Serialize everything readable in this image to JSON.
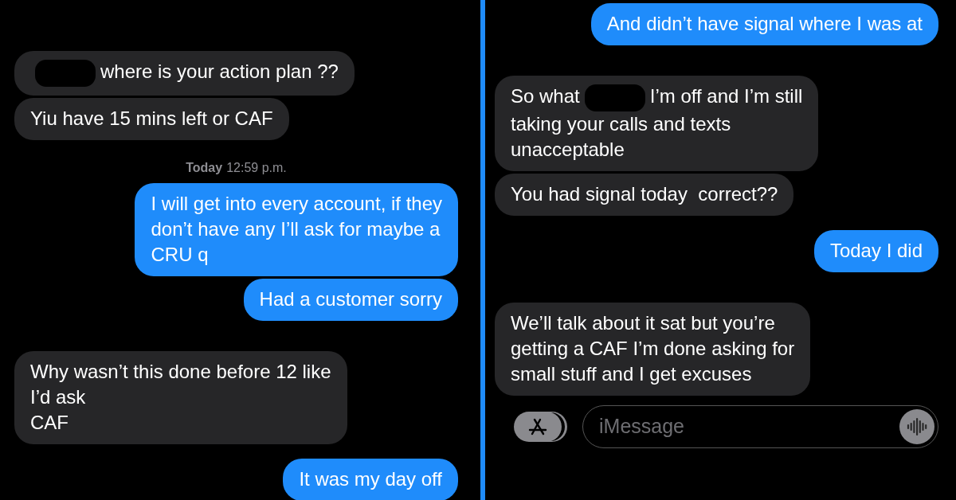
{
  "panels": [
    {
      "messages": [
        {
          "kind": "received",
          "segments": [
            {
              "kind": "redacted"
            },
            {
              "kind": "text",
              "text": "where is your action plan ??"
            }
          ]
        },
        {
          "kind": "received",
          "segments": [
            {
              "kind": "text",
              "text": "Yiu have 15 mins left or CAF"
            }
          ]
        },
        {
          "kind": "timestamp",
          "day": "Today",
          "time": "12:59 p.m."
        },
        {
          "kind": "sent",
          "segments": [
            {
              "kind": "text",
              "text": "I will get into every account, if they\ndon’t have any I’ll ask for maybe a\nCRU q"
            }
          ]
        },
        {
          "kind": "sent",
          "segments": [
            {
              "kind": "text",
              "text": "Had a customer sorry"
            }
          ]
        },
        {
          "kind": "received",
          "segments": [
            {
              "kind": "text",
              "text": "Why wasn’t this done before 12 like\nI’d ask\nCAF"
            }
          ]
        },
        {
          "kind": "sent",
          "segments": [
            {
              "kind": "text",
              "text": "It was my day off"
            }
          ]
        }
      ]
    },
    {
      "messages": [
        {
          "kind": "sent",
          "segments": [
            {
              "kind": "text",
              "text": "And didn’t have signal where I was at"
            }
          ]
        },
        {
          "kind": "received",
          "segments": [
            {
              "kind": "text",
              "text": "So what"
            },
            {
              "kind": "redacted"
            },
            {
              "kind": "text",
              "text": "I’m off and I’m still\ntaking your calls and texts\nunacceptable"
            }
          ]
        },
        {
          "kind": "received",
          "segments": [
            {
              "kind": "text",
              "text": "You had signal today  correct??"
            }
          ]
        },
        {
          "kind": "sent",
          "segments": [
            {
              "kind": "text",
              "text": "Today I did"
            }
          ]
        },
        {
          "kind": "received",
          "segments": [
            {
              "kind": "text",
              "text": "We’ll talk about it sat but you’re\ngetting a CAF I’m done asking for\nsmall stuff and I get excuses"
            }
          ]
        }
      ],
      "composer": {
        "placeholder": "iMessage"
      }
    }
  ]
}
